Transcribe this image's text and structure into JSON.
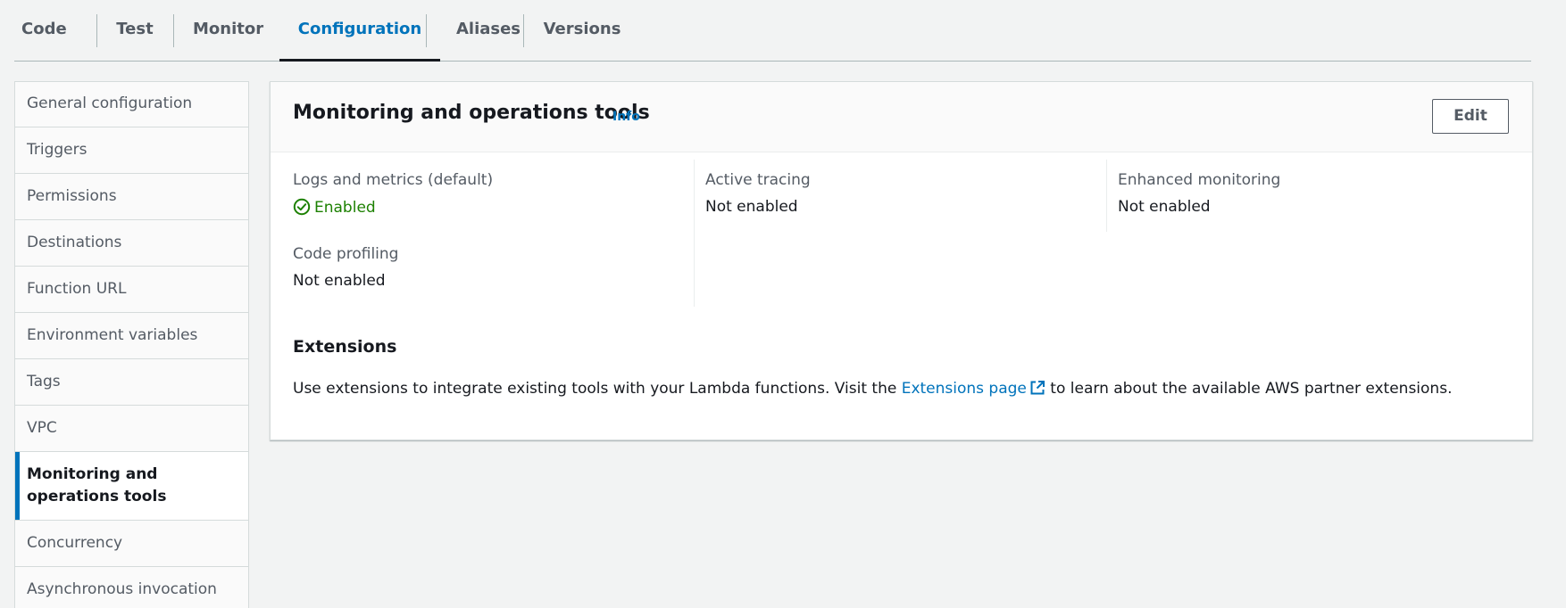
{
  "tabs": [
    {
      "label": "Code"
    },
    {
      "label": "Test"
    },
    {
      "label": "Monitor"
    },
    {
      "label": "Configuration",
      "active": true
    },
    {
      "label": "Aliases"
    },
    {
      "label": "Versions"
    }
  ],
  "sidebar": {
    "items": [
      {
        "label": "General configuration"
      },
      {
        "label": "Triggers"
      },
      {
        "label": "Permissions"
      },
      {
        "label": "Destinations"
      },
      {
        "label": "Function URL"
      },
      {
        "label": "Environment variables"
      },
      {
        "label": "Tags"
      },
      {
        "label": "VPC"
      },
      {
        "label": "Monitoring and operations tools",
        "selected": true
      },
      {
        "label": "Concurrency"
      },
      {
        "label": "Asynchronous invocation"
      }
    ]
  },
  "panel": {
    "title": "Monitoring and operations tools",
    "info_label": "Info",
    "edit_label": "Edit",
    "logs": {
      "label": "Logs and metrics (default)",
      "value": "Enabled"
    },
    "tracing": {
      "label": "Active tracing",
      "value": "Not enabled"
    },
    "enhanced": {
      "label": "Enhanced monitoring",
      "value": "Not enabled"
    },
    "profiling": {
      "label": "Code profiling",
      "value": "Not enabled"
    },
    "extensions": {
      "heading": "Extensions",
      "text_before": "Use extensions to integrate existing tools with your Lambda functions. Visit the ",
      "link_label": "Extensions page",
      "text_after": " to learn about the available AWS partner extensions."
    }
  },
  "colors": {
    "accent": "#0073bb",
    "success": "#1d8102",
    "text": "#16191f",
    "muted": "#545b64"
  },
  "icons": {
    "enabled": "check-circle-icon",
    "external": "external-link-icon"
  }
}
